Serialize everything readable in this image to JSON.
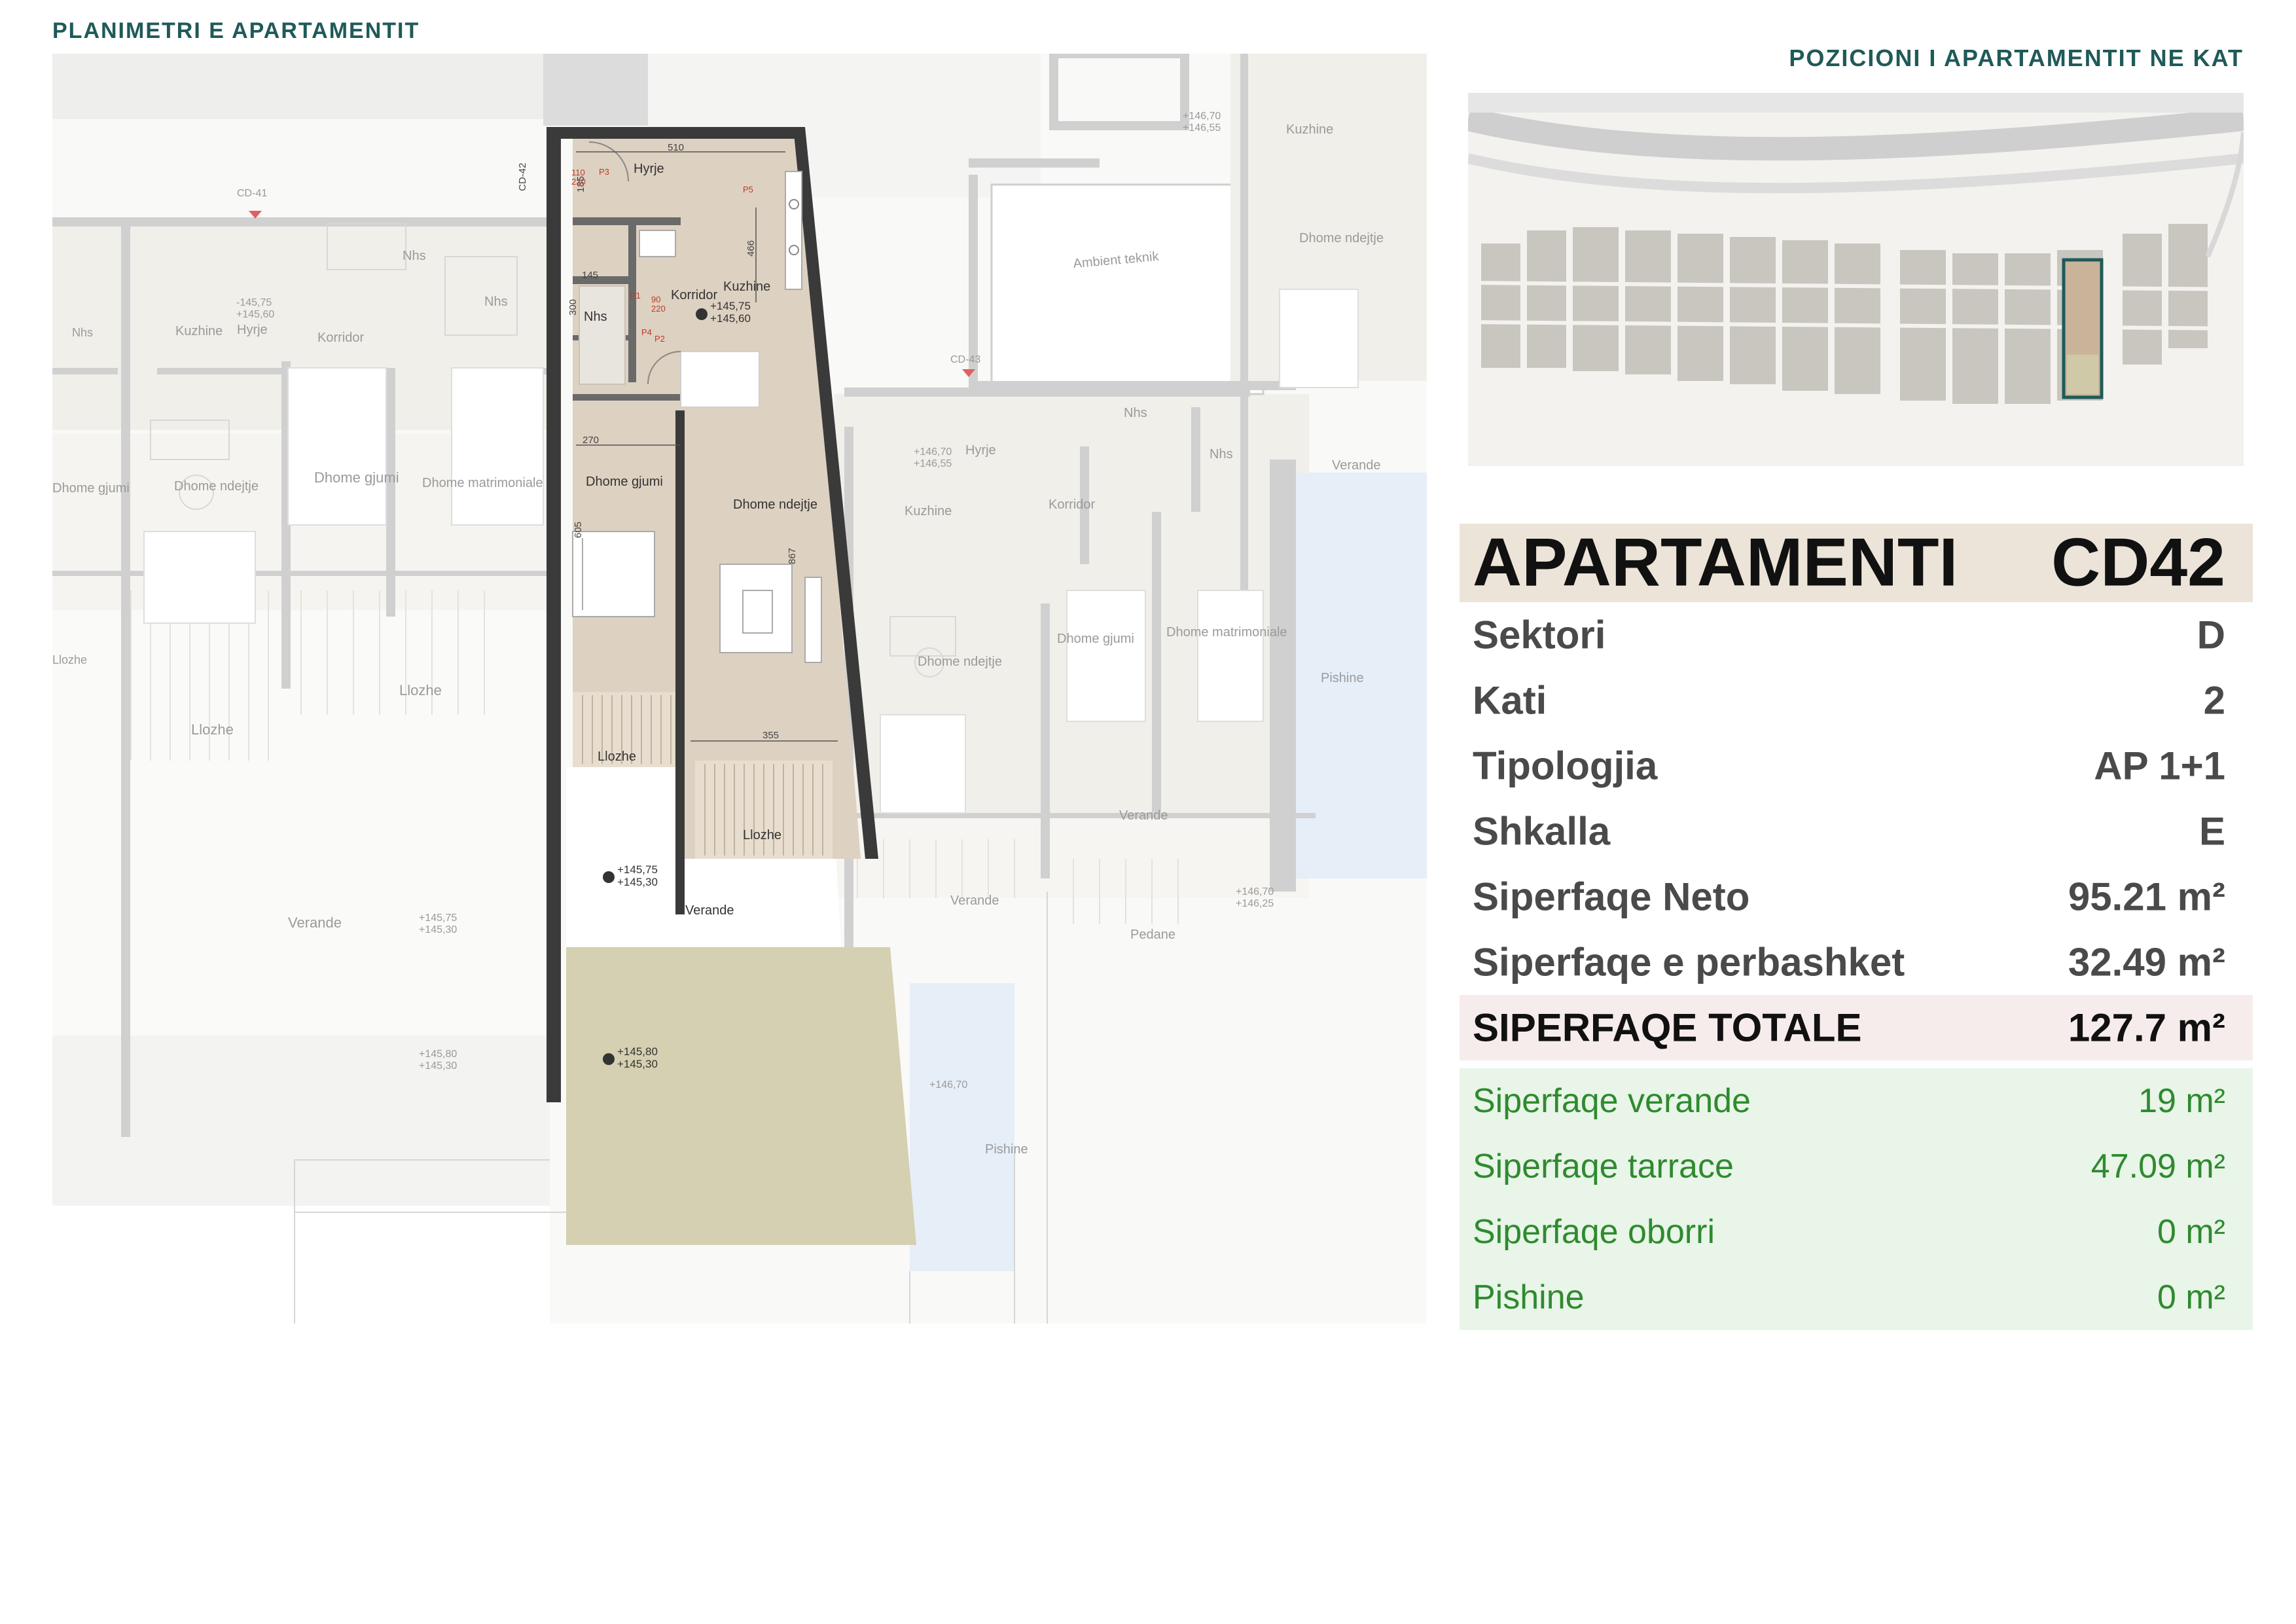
{
  "header": {
    "title_left": "PLANIMETRI  E APARTAMENTIT",
    "title_right": "POZICIONI I APARTAMENTIT NE KAT"
  },
  "plan": {
    "unit_labels": [
      "CD-41",
      "CD-42",
      "CD-43"
    ],
    "rooms": {
      "hyrje": "Hyrje",
      "nhs": "Nhs",
      "korridor": "Korridor",
      "kuzhine": "Kuzhine",
      "dhome_gjumi": "Dhome gjumi",
      "dhome_ndejtje": "Dhome ndejtje",
      "llozhe_1": "Llozhe",
      "llozhe_2": "Llozhe",
      "verande": "Verande"
    },
    "neighbor_labels": {
      "hyrje_l": "Hyrje",
      "nhs_l1": "Nhs",
      "nhs_l2": "Nhs",
      "nhs_l3": "Nhs",
      "kuzhine_l": "Kuzhine",
      "korridor_l": "Korridor",
      "dhome_gjumi_l": "Dhome gjumi",
      "dhome_gjumi_l2": "Dhome gjumi",
      "dhome_ndejtje_l": "Dhome ndejtje",
      "dhome_matr_l": "Dhome matrimoniale",
      "llozhe_l1": "Llozhe",
      "llozhe_l2": "Llozhe",
      "llozhe_l3": "Llozhe",
      "verande_l": "Verande",
      "ambient": "Ambient teknik",
      "kuzhine_tr": "Kuzhine",
      "dhome_ndejtje_tr": "Dhome ndejtje",
      "hyrje_r": "Hyrje",
      "nhs_r1": "Nhs",
      "nhs_r2": "Nhs",
      "kuzhine_r": "Kuzhine",
      "korridor_r": "Korridor",
      "dhome_gjumi_r": "Dhome gjumi",
      "dhome_matr_r": "Dhome matrimoniale",
      "dhome_ndejtje_r": "Dhome ndejtje",
      "verande_r1": "Verande",
      "verande_r2": "Verande",
      "verande_r3": "Verande",
      "pedane": "Pedane",
      "pishine_1": "Pishine",
      "pishine_2": "Pishine"
    },
    "dims": {
      "d510": "510",
      "d466": "466",
      "d145": "145",
      "d270": "270",
      "d605": "605",
      "d867": "867",
      "d355": "355",
      "d185": "185",
      "d300": "300"
    },
    "levels": {
      "main_a": "+145,75",
      "main_b": "+145,60",
      "verande_a": "+145,75",
      "verande_b": "+145,30",
      "terrace_a": "+145,80",
      "terrace_b": "+145,30",
      "left_a": "-145,75",
      "left_b": "+145,60",
      "lv_a": "+145,75",
      "lv_b": "+145,30",
      "lt_a": "+145,80",
      "lt_b": "+145,30",
      "tr_a": "+146,70",
      "tr_b": "+146,55",
      "r_a": "+146,70",
      "r_b": "+146,55",
      "rv_a": "+146,70",
      "rv_b": "+146,25",
      "pool": "+146,70"
    },
    "door_tags": {
      "p1": "P1",
      "p2": "P2",
      "p3": "P3",
      "p4": "P4",
      "p5": "P5",
      "w1": "110",
      "w2": "220",
      "w3": "90",
      "w4": "220"
    },
    "colors": {
      "apartment_fill": "#ddd1c1",
      "terrace_fill": "#d4d0b1",
      "wall": "#3a3a3a",
      "neighbor_fill": "#f1efea",
      "pool_fill": "#e4eef8"
    }
  },
  "apartment": {
    "label": "APARTAMENTI",
    "code": "CD42",
    "rows": [
      {
        "label": "Sektori",
        "value": "D"
      },
      {
        "label": "Kati",
        "value": "2"
      },
      {
        "label": "Tipologjia",
        "value": "AP 1+1"
      },
      {
        "label": "Shkalla",
        "value": "E"
      },
      {
        "label": "Siperfaqe Neto",
        "value": "95.21 m²"
      },
      {
        "label": "Siperfaqe e perbashket",
        "value": "32.49 m²"
      }
    ],
    "total": {
      "label": "SIPERFAQE TOTALE",
      "value": "127.7 m²"
    },
    "extras": [
      {
        "label": "Siperfaqe verande",
        "value": "19 m²"
      },
      {
        "label": "Siperfaqe tarrace",
        "value": "47.09 m²"
      },
      {
        "label": "Siperfaqe oborri",
        "value": "0 m²"
      },
      {
        "label": "Pishine",
        "value": "0 m²"
      }
    ]
  }
}
